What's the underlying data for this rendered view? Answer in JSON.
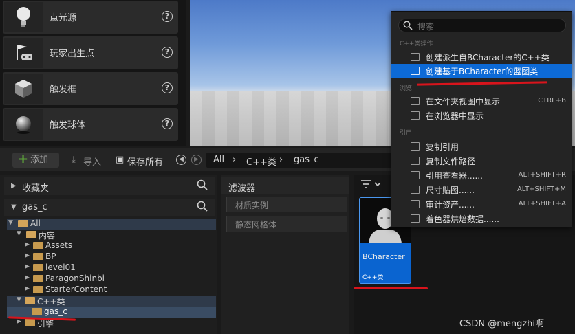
{
  "place_actors": {
    "items": [
      {
        "label": "点光源",
        "icon": "bulb-icon"
      },
      {
        "label": "玩家出生点",
        "icon": "player-start-icon"
      },
      {
        "label": "触发框",
        "icon": "trigger-box-icon"
      },
      {
        "label": "触发球体",
        "icon": "trigger-sphere-icon"
      }
    ],
    "help_glyph": "?"
  },
  "toolbar": {
    "add_label": "添加",
    "import_label": "导入",
    "save_all_label": "保存所有",
    "breadcrumb": [
      "All",
      "C++类",
      "gas_c"
    ]
  },
  "sources": {
    "favorites_label": "收藏夹",
    "root_label": "gas_c",
    "tree": [
      {
        "label": "All",
        "level": 0,
        "open": true
      },
      {
        "label": "内容",
        "level": 1,
        "open": true
      },
      {
        "label": "Assets",
        "level": 2
      },
      {
        "label": "BP",
        "level": 2
      },
      {
        "label": "level01",
        "level": 2
      },
      {
        "label": "ParagonShinbi",
        "level": 2
      },
      {
        "label": "StarterContent",
        "level": 2
      },
      {
        "label": "C++类",
        "level": 1,
        "open": true
      },
      {
        "label": "gas_c",
        "level": 2,
        "selected": true
      },
      {
        "label": "引擎",
        "level": 1
      }
    ]
  },
  "filters": {
    "header": "滤波器",
    "items": [
      "材质实例",
      "静态网格体"
    ]
  },
  "asset": {
    "name": "BCharacter",
    "type": "C++类"
  },
  "context_menu": {
    "search_placeholder": "搜索",
    "section_cpp": "C++类操作",
    "section_explore": "浏览",
    "section_reference": "引用",
    "items_cpp": [
      {
        "label": "创建派生自BCharacter的C++类",
        "shortcut": ""
      },
      {
        "label": "创建基于BCharacter的蓝图类",
        "shortcut": "",
        "highlighted": true
      }
    ],
    "items_explore": [
      {
        "label": "在文件夹视图中显示",
        "shortcut": "CTRL+B"
      },
      {
        "label": "在浏览器中显示",
        "shortcut": ""
      }
    ],
    "items_reference": [
      {
        "label": "复制引用",
        "shortcut": ""
      },
      {
        "label": "复制文件路径",
        "shortcut": ""
      },
      {
        "label": "引用查看器......",
        "shortcut": "ALT+SHIFT+R"
      },
      {
        "label": "尺寸贴图......",
        "shortcut": "ALT+SHIFT+M"
      },
      {
        "label": "审计资产......",
        "shortcut": "ALT+SHIFT+A"
      },
      {
        "label": "着色器烘焙数据......",
        "shortcut": ""
      }
    ]
  },
  "watermark": "CSDN @mengzhi啊",
  "colors": {
    "highlight": "#0d6ad6",
    "annotation_red": "#d8141c",
    "folder": "#c79a4e"
  }
}
